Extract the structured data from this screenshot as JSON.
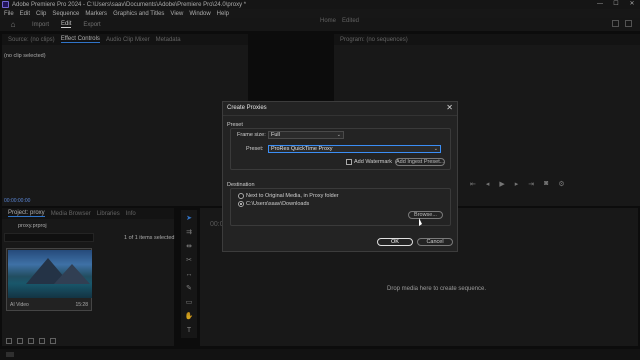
{
  "window": {
    "title": "Adobe Premiere Pro 2024 - C:\\Users\\saav\\Documents\\Adobe\\Premiere Pro\\24.0\\proxy *",
    "controls": [
      "—",
      "☐",
      "✕"
    ]
  },
  "menu": [
    "File",
    "Edit",
    "Clip",
    "Sequence",
    "Markers",
    "Graphics and Titles",
    "View",
    "Window",
    "Help"
  ],
  "workspace": {
    "tabs": [
      "Import",
      "Edit",
      "Export"
    ],
    "active_tab": "Edit",
    "right_labels": [
      "Home",
      "Edited"
    ]
  },
  "source_panel": {
    "tabs": [
      "Source: (no clips)",
      "Effect Controls",
      "Audio Clip Mixer",
      "Metadata"
    ],
    "active_tab": "Effect Controls",
    "subhead": "(no clip selected)",
    "timecode": "00:00:00:00"
  },
  "program_panel": {
    "tabs": [
      "Program: (no sequences)"
    ]
  },
  "project_panel": {
    "tabs": [
      "Project: proxy",
      "Media Browser",
      "Libraries",
      "Info"
    ],
    "active_tab": "Project: proxy",
    "file": "proxy.prproj",
    "item_count": "1 of 1 items selected",
    "clip": {
      "name": "AI Video",
      "duration": "15:28"
    }
  },
  "timeline": {
    "timecode": "00:00:00:00",
    "drop_text": "Drop media here to create sequence."
  },
  "dialog": {
    "title": "Create Proxies",
    "close": "✕",
    "preset_group": "Preset",
    "frame_size_label": "Frame size:",
    "frame_size_value": "Full",
    "preset_label": "Preset:",
    "preset_value": "ProRes QuickTime Proxy",
    "add_watermark": "Add Watermark",
    "add_ingest_preset": "Add Ingest Preset...",
    "destination_group": "Destination",
    "dest_option1": "Next to Original Media, in Proxy folder",
    "dest_option2": "C:\\Users\\saav\\Downloads",
    "browse": "Browse...",
    "ok": "OK",
    "cancel": "Cancel"
  }
}
